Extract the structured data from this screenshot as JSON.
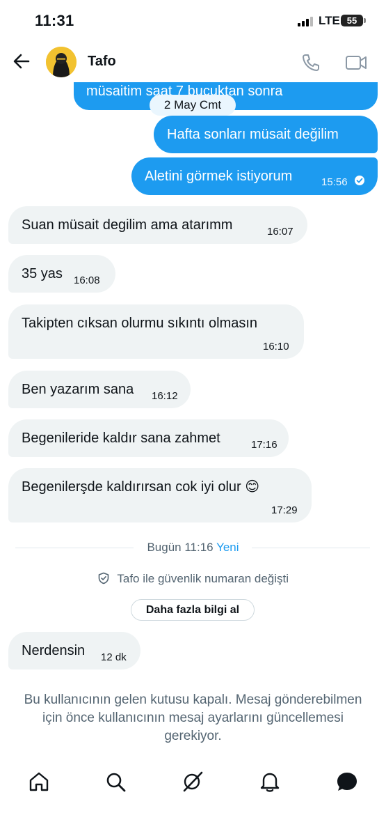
{
  "status_bar": {
    "time": "11:31",
    "network": "LTE",
    "battery": "55"
  },
  "header": {
    "contact_name": "Tafo"
  },
  "messages": {
    "cutoff_text": "müsaitim saat 7 buçuktan sonra",
    "date_chip": "2 May Cmt",
    "out_1": {
      "text": "Hafta sonları müsait değilim"
    },
    "out_2": {
      "text": "Aletini görmek istiyorum",
      "time": "15:56"
    },
    "in_1": {
      "text": "Suan müsait degilim ama atarımm",
      "time": "16:07"
    },
    "in_2": {
      "text": "35 yas",
      "time": "16:08"
    },
    "in_3": {
      "text": "Takipten cıksan olurmu sıkıntı olmasın",
      "time": "16:10"
    },
    "in_4": {
      "text": "Ben yazarım sana",
      "time": "16:12"
    },
    "in_5": {
      "text": "Begenileride kaldır sana zahmet",
      "time": "17:16"
    },
    "in_6": {
      "text": "Begenilerşde kaldırırsan  cok iyi olur 😊",
      "time": "17:29"
    },
    "in_7": {
      "text": "Nerdensin",
      "time": "12 dk"
    }
  },
  "divider": {
    "label": "Bugün 11:16",
    "new_label": "Yeni"
  },
  "security": {
    "text": "Tafo ile güvenlik numaran değişti",
    "button": "Daha fazla bilgi al"
  },
  "notice": "Bu kullanıcının gelen kutusu kapalı. Mesaj gönderebilmen için önce kullanıcının mesaj ayarlarını güncellemesi gerekiyor.",
  "tabbar": {
    "icons": [
      "home-icon",
      "search-icon",
      "grok-icon",
      "notifications-icon",
      "messages-icon"
    ]
  },
  "colors": {
    "accent": "#1d9bf0",
    "incoming_bubble": "#eff3f4",
    "secondary_text": "#536471"
  }
}
